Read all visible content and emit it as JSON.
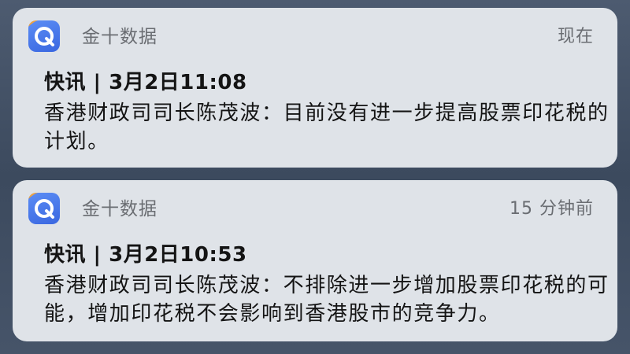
{
  "notifications": [
    {
      "app_name": "金十数据",
      "app_icon": "jin10-app-icon",
      "time": "现在",
      "title": "快讯 | 3月2日11:08",
      "body": "香港财政司司长陈茂波：目前没有进一步提高股票印花税的计划。"
    },
    {
      "app_name": "金十数据",
      "app_icon": "jin10-app-icon",
      "time": "15 分钟前",
      "title": "快讯 | 3月2日10:53",
      "body": "香港财政司司长陈茂波：不排除进一步增加股票印花税的可能，增加印花税不会影响到香港股市的竞争力。"
    }
  ],
  "colors": {
    "card_background": "#dfe3e8",
    "wallpaper": "#3e4d63",
    "icon_blue": "#3a67e0",
    "secondary_text": "#6a6d72",
    "primary_text": "#141414"
  }
}
